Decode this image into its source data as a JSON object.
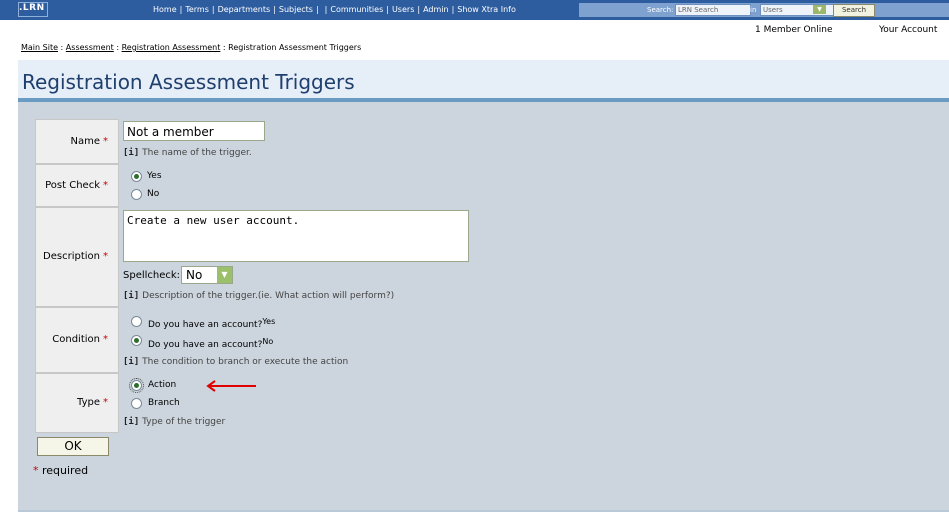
{
  "topbar": {
    "logo": ".LRN",
    "nav": [
      "Home",
      "Terms",
      "Departments",
      "Subjects",
      "",
      "Communities",
      "Users",
      "Admin",
      "Show Xtra Info"
    ],
    "search_label": "Search:",
    "search_placeholder": "LRN Search",
    "in_label": "in",
    "scope_value": "Users",
    "search_button": "Search"
  },
  "header": {
    "members_online": "1 Member Online",
    "your_account": "Your Account"
  },
  "breadcrumb": {
    "items": [
      "Main Site",
      "Assessment",
      "Registration Assessment"
    ],
    "current": "Registration Assessment Triggers",
    "separator": ":"
  },
  "page": {
    "title": "Registration Assessment Triggers"
  },
  "form": {
    "name": {
      "label": "Name",
      "value": "Not a member",
      "hint": "The name of the trigger."
    },
    "post_check": {
      "label": "Post Check",
      "options": [
        "Yes",
        "No"
      ],
      "selected": "Yes"
    },
    "description": {
      "label": "Description",
      "value": "Create a new user account.",
      "spellcheck_label": "Spellcheck:",
      "spellcheck_value": "No",
      "hint": "Description of the trigger.(ie. What action will perform?)"
    },
    "condition": {
      "label": "Condition",
      "options": [
        {
          "text": "Do you have an account?",
          "suffix": "Yes"
        },
        {
          "text": "Do you have an account?",
          "suffix": "No"
        }
      ],
      "selected_index": 1,
      "hint": "The condition to branch or execute the action"
    },
    "type": {
      "label": "Type",
      "options": [
        "Action",
        "Branch"
      ],
      "selected": "Action",
      "hint": "Type of the trigger"
    },
    "required_star": "*",
    "hint_marker": "[i]",
    "ok_button": "OK",
    "required_note": "required"
  },
  "colors": {
    "accent": "#2e5d9f",
    "title": "#1f3f6e",
    "required": "#cc0000",
    "annotation_arrow": "#e00000"
  },
  "icons": [
    "dropdown-arrow-icon",
    "red-arrow-icon"
  ]
}
